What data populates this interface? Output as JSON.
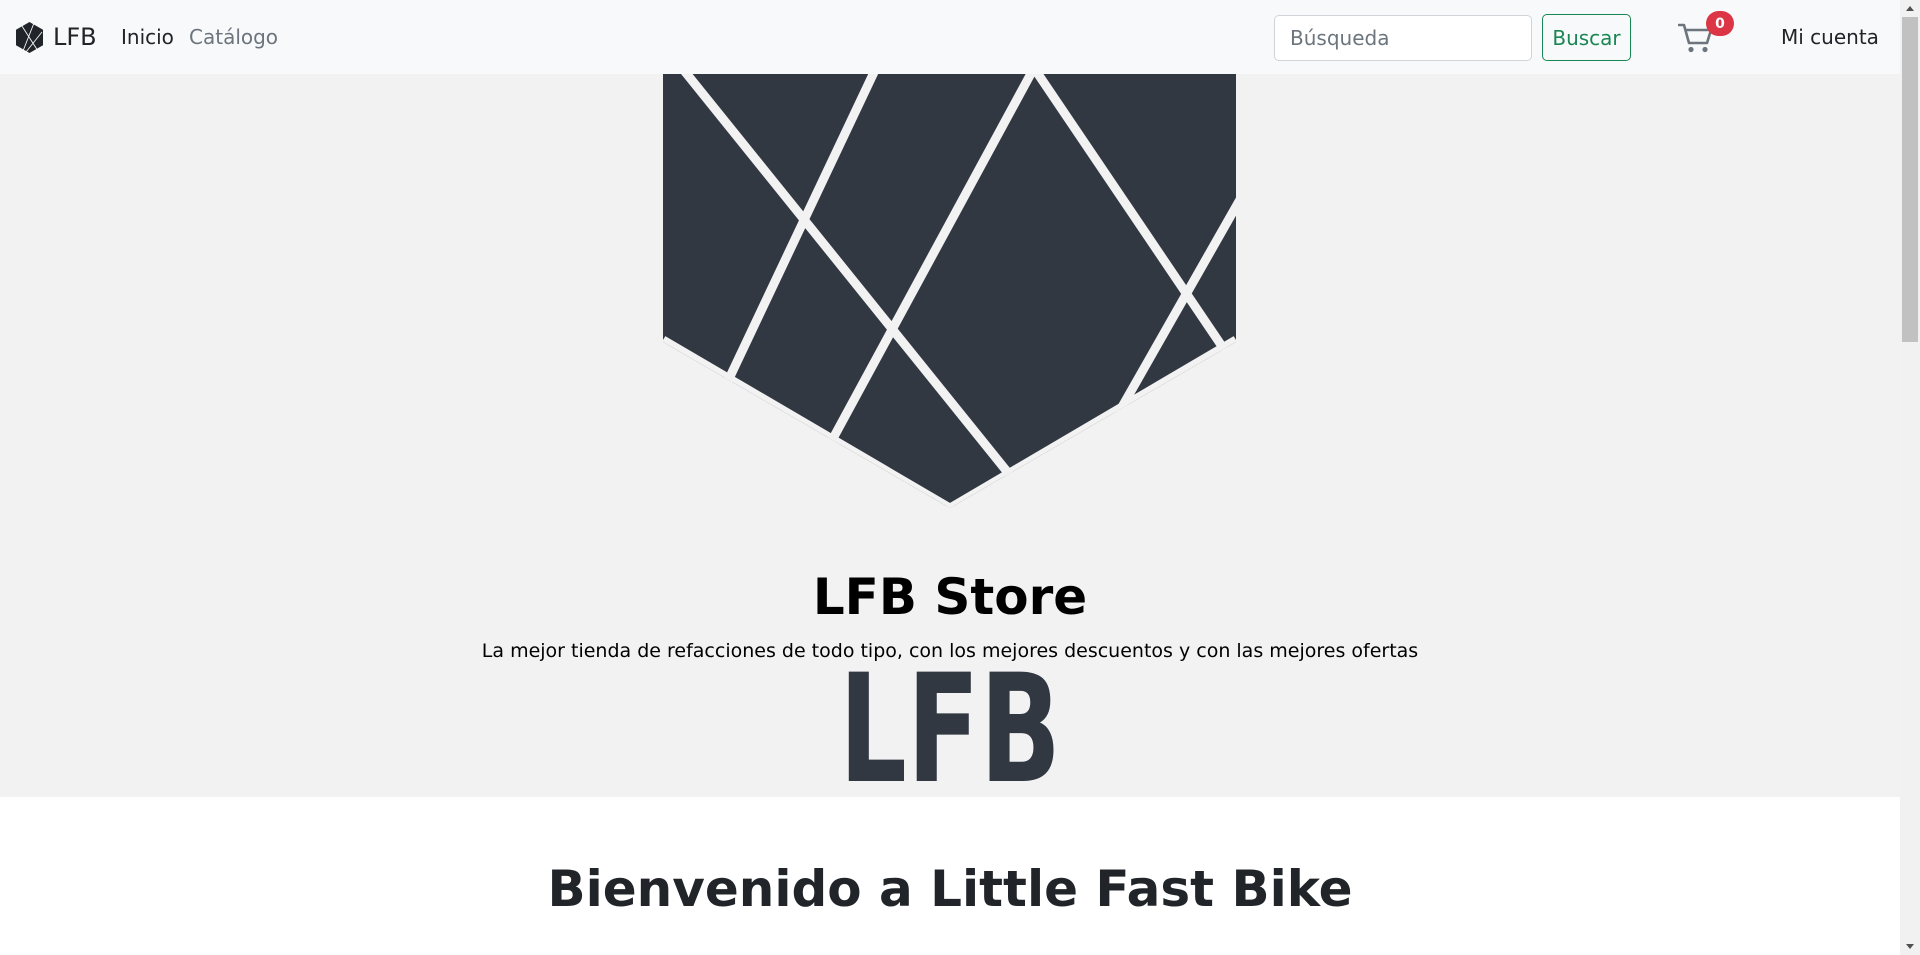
{
  "navbar": {
    "brand": "LFB",
    "links": [
      {
        "label": "Inicio"
      },
      {
        "label": "Catálogo"
      }
    ],
    "search": {
      "placeholder": "Búsqueda",
      "value": ""
    },
    "search_button": "Buscar",
    "cart_count": "0",
    "account": "Mi cuenta"
  },
  "hero": {
    "title": "LFB Store",
    "subtitle": "La mejor tienda de refacciones de todo tipo, con los mejores descuentos y con las mejores ofertas",
    "logo_text": "LFB"
  },
  "welcome": {
    "heading": "Bienvenido a Little Fast Bike"
  },
  "colors": {
    "navbar_bg": "#f8f9fa",
    "hero_bg": "#f2f2f2",
    "logo_dark": "#313842",
    "success": "#198754",
    "badge": "#dc3545"
  }
}
